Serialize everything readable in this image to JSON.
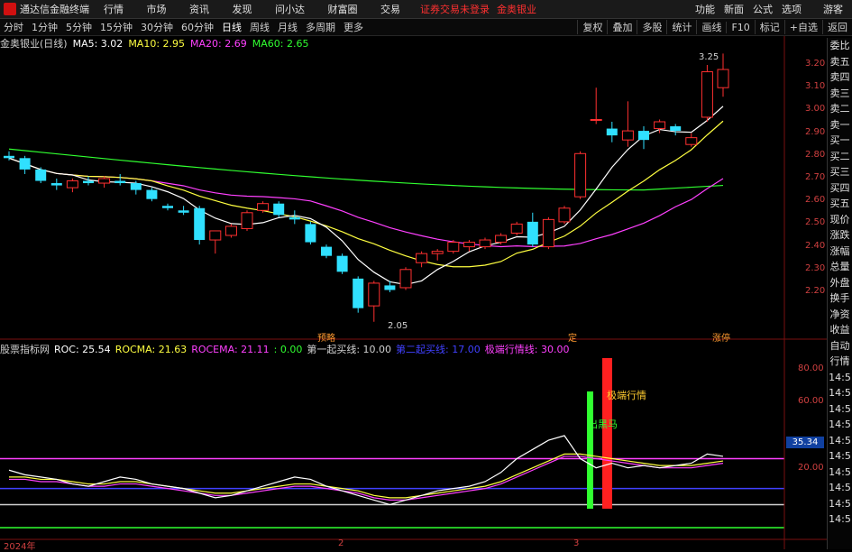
{
  "titlebar": {
    "app_name": "通达信金融终端",
    "menu": [
      "行情",
      "市场",
      "资讯",
      "发现",
      "问小达",
      "财富圈",
      "交易"
    ],
    "alerts": [
      "证券交易未登录",
      "金奥银业"
    ],
    "right": [
      "功能",
      "新面",
      "公式",
      "选项",
      "游客"
    ]
  },
  "toolbar": {
    "periods": [
      "分时",
      "1分钟",
      "5分钟",
      "15分钟",
      "30分钟",
      "60分钟",
      "日线",
      "周线",
      "月线",
      "多周期",
      "更多"
    ],
    "active_period": "日线",
    "tools": [
      "复权",
      "叠加",
      "多股",
      "统计",
      "画线",
      "F10",
      "标记",
      "+自选",
      "返回"
    ]
  },
  "kline": {
    "stock": "金奥银业(日线)",
    "ma5": "MA5: 3.02",
    "ma10": "MA10: 2.95",
    "ma20": "MA20: 2.69",
    "ma60": "MA60: 2.65",
    "high_label": "3.25",
    "low_label": "2.05",
    "markers": [
      "预略",
      "定",
      "涨停"
    ]
  },
  "sub_indicator": {
    "name": "股票指标网",
    "roc": "ROC: 25.54",
    "rocma": "ROCMA: 21.63",
    "rocema": "ROCEMA: 21.11",
    "zero": ": 0.00",
    "buy1": "第一起买线: 10.00",
    "buy2": "第二起买线: 17.00",
    "extreme": "极端行情线: 30.00",
    "label_extreme": "极端行情",
    "label_dark_horse": "出黑马",
    "current_value": "35.34"
  },
  "right_panel": [
    "委比",
    "卖五",
    "卖四",
    "卖三",
    "卖二",
    "卖一",
    "买一",
    "买二",
    "买三",
    "买四",
    "买五",
    "现价",
    "涨跌",
    "涨幅",
    "总量",
    "外盘",
    "换手",
    "净资",
    "收益",
    "自动",
    "行情",
    "14:5",
    "14:5",
    "14:5",
    "14:5",
    "14:5",
    "14:5",
    "14:5",
    "14:5",
    "14:5",
    "14:5"
  ],
  "price_axis": [
    "3.20",
    "3.10",
    "3.00",
    "2.90",
    "2.80",
    "2.70",
    "2.60",
    "2.50",
    "2.40",
    "2.30",
    "2.20"
  ],
  "sub_axis": [
    "80.00",
    "60.00",
    "20.00"
  ],
  "date_axis": [
    "2024年",
    "2",
    "3"
  ],
  "colors": {
    "up": "#ff3030",
    "down": "#30e0ff",
    "ma5": "#ffffff",
    "ma10": "#ffff40",
    "ma20": "#ff40ff",
    "ma60": "#30ff30"
  },
  "chart_data": {
    "type": "candlestick",
    "ylim": [
      2.05,
      3.25
    ],
    "candles": [
      {
        "o": 2.8,
        "h": 2.82,
        "l": 2.78,
        "c": 2.79
      },
      {
        "o": 2.79,
        "h": 2.8,
        "l": 2.72,
        "c": 2.74
      },
      {
        "o": 2.74,
        "h": 2.75,
        "l": 2.68,
        "c": 2.69
      },
      {
        "o": 2.68,
        "h": 2.7,
        "l": 2.65,
        "c": 2.67
      },
      {
        "o": 2.66,
        "h": 2.7,
        "l": 2.64,
        "c": 2.69
      },
      {
        "o": 2.69,
        "h": 2.71,
        "l": 2.67,
        "c": 2.68
      },
      {
        "o": 2.68,
        "h": 2.71,
        "l": 2.66,
        "c": 2.7
      },
      {
        "o": 2.69,
        "h": 2.72,
        "l": 2.67,
        "c": 2.68
      },
      {
        "o": 2.68,
        "h": 2.69,
        "l": 2.63,
        "c": 2.65
      },
      {
        "o": 2.65,
        "h": 2.66,
        "l": 2.6,
        "c": 2.61
      },
      {
        "o": 2.58,
        "h": 2.59,
        "l": 2.56,
        "c": 2.57
      },
      {
        "o": 2.56,
        "h": 2.58,
        "l": 2.54,
        "c": 2.55
      },
      {
        "o": 2.57,
        "h": 2.58,
        "l": 2.41,
        "c": 2.43
      },
      {
        "o": 2.43,
        "h": 2.47,
        "l": 2.37,
        "c": 2.47
      },
      {
        "o": 2.45,
        "h": 2.5,
        "l": 2.44,
        "c": 2.49
      },
      {
        "o": 2.48,
        "h": 2.56,
        "l": 2.47,
        "c": 2.55
      },
      {
        "o": 2.56,
        "h": 2.6,
        "l": 2.55,
        "c": 2.59
      },
      {
        "o": 2.59,
        "h": 2.6,
        "l": 2.53,
        "c": 2.54
      },
      {
        "o": 2.53,
        "h": 2.56,
        "l": 2.5,
        "c": 2.52
      },
      {
        "o": 2.5,
        "h": 2.51,
        "l": 2.41,
        "c": 2.42
      },
      {
        "o": 2.4,
        "h": 2.41,
        "l": 2.35,
        "c": 2.36
      },
      {
        "o": 2.36,
        "h": 2.37,
        "l": 2.28,
        "c": 2.29
      },
      {
        "o": 2.26,
        "h": 2.27,
        "l": 2.11,
        "c": 2.13
      },
      {
        "o": 2.14,
        "h": 2.25,
        "l": 2.07,
        "c": 2.24
      },
      {
        "o": 2.23,
        "h": 2.25,
        "l": 2.2,
        "c": 2.21
      },
      {
        "o": 2.22,
        "h": 2.31,
        "l": 2.21,
        "c": 2.3
      },
      {
        "o": 2.33,
        "h": 2.38,
        "l": 2.31,
        "c": 2.37
      },
      {
        "o": 2.37,
        "h": 2.39,
        "l": 2.34,
        "c": 2.38
      },
      {
        "o": 2.38,
        "h": 2.43,
        "l": 2.37,
        "c": 2.42
      },
      {
        "o": 2.4,
        "h": 2.43,
        "l": 2.38,
        "c": 2.42
      },
      {
        "o": 2.4,
        "h": 2.44,
        "l": 2.39,
        "c": 2.43
      },
      {
        "o": 2.42,
        "h": 2.46,
        "l": 2.41,
        "c": 2.45
      },
      {
        "o": 2.46,
        "h": 2.51,
        "l": 2.45,
        "c": 2.5
      },
      {
        "o": 2.51,
        "h": 2.55,
        "l": 2.4,
        "c": 2.41
      },
      {
        "o": 2.4,
        "h": 2.53,
        "l": 2.39,
        "c": 2.52
      },
      {
        "o": 2.51,
        "h": 2.58,
        "l": 2.5,
        "c": 2.57
      },
      {
        "o": 2.62,
        "h": 2.82,
        "l": 2.61,
        "c": 2.81
      },
      {
        "o": 2.96,
        "h": 3.1,
        "l": 2.94,
        "c": 2.96
      },
      {
        "o": 2.92,
        "h": 2.95,
        "l": 2.86,
        "c": 2.89
      },
      {
        "o": 2.87,
        "h": 3.04,
        "l": 2.84,
        "c": 2.91
      },
      {
        "o": 2.91,
        "h": 2.93,
        "l": 2.83,
        "c": 2.87
      },
      {
        "o": 2.92,
        "h": 2.96,
        "l": 2.9,
        "c": 2.95
      },
      {
        "o": 2.93,
        "h": 2.94,
        "l": 2.89,
        "c": 2.91
      },
      {
        "o": 2.85,
        "h": 2.9,
        "l": 2.84,
        "c": 2.88
      },
      {
        "o": 2.97,
        "h": 3.2,
        "l": 2.95,
        "c": 3.17
      },
      {
        "o": 3.1,
        "h": 3.25,
        "l": 3.06,
        "c": 3.18
      }
    ],
    "sub": {
      "roc": [
        25,
        23,
        22,
        21,
        19,
        18,
        20,
        22,
        21,
        19,
        18,
        17,
        15,
        13,
        14,
        16,
        18,
        20,
        22,
        21,
        18,
        16,
        14,
        12,
        10,
        12,
        14,
        16,
        17,
        18,
        20,
        24,
        30,
        34,
        38,
        40,
        30,
        26,
        28,
        26,
        27,
        26,
        27,
        28,
        32,
        31
      ],
      "rocma": [
        22,
        22,
        21,
        21,
        20,
        19,
        19,
        20,
        20,
        19,
        18,
        17,
        16,
        15,
        15,
        16,
        17,
        18,
        19,
        19,
        18,
        17,
        16,
        14,
        13,
        13,
        14,
        15,
        16,
        17,
        18,
        20,
        23,
        26,
        29,
        32,
        32,
        31,
        30,
        29,
        28,
        27,
        27,
        27,
        28,
        29
      ],
      "levels": {
        "zero": 0,
        "buy1": 10,
        "buy2": 17,
        "extreme": 30
      }
    }
  }
}
